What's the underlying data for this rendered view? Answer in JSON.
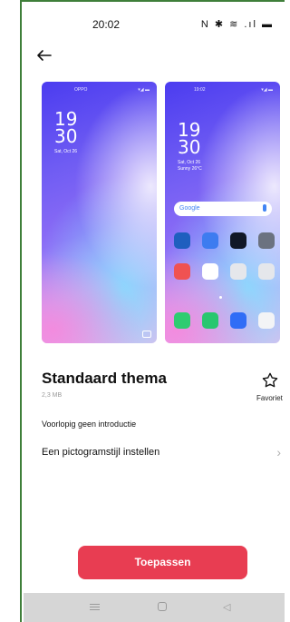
{
  "status_bar": {
    "time": "20:02",
    "icons": "N ✱ ≋ .ıl ▬"
  },
  "preview_lock": {
    "brand": "OPPO",
    "status": "▾◢ ▬",
    "clock_hour": "19",
    "clock_min": "30",
    "date": "Sat, Oct 26"
  },
  "preview_home": {
    "time": "19:02",
    "status": "▾◢ ▬",
    "clock_hour": "19",
    "clock_min": "30",
    "date_line1": "Sat, Oct 26",
    "date_line2": "Sunny 26°C",
    "search_label": "Google"
  },
  "theme": {
    "title": "Standaard thema",
    "size": "2,3 MB",
    "favorite_label": "Favoriet",
    "intro": "Voorlopig geen introductie",
    "icon_style_label": "Een pictogramstijl instellen"
  },
  "actions": {
    "apply_label": "Toepassen"
  },
  "colors": {
    "accent": "#e83d52",
    "frame": "#3f7f3a",
    "navbar": "#d6d6d6"
  },
  "icons": {
    "back": "arrow-left-icon",
    "favorite": "star-outline-icon",
    "chevron": "chevron-right-icon",
    "nav_menu": "menu-icon",
    "nav_home": "home-icon",
    "nav_back": "back-triangle-icon"
  }
}
